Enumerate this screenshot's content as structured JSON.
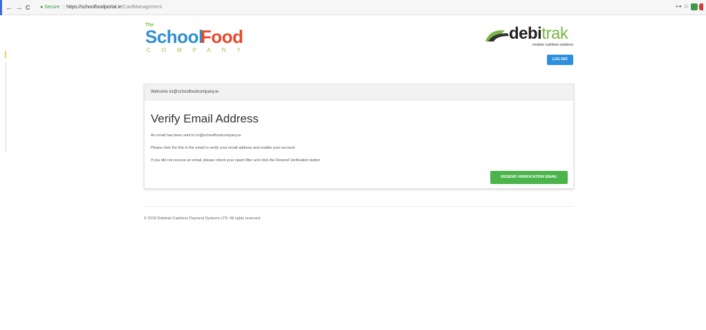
{
  "browser": {
    "back_icon": "←",
    "forward_icon": "→",
    "reload_icon": "C",
    "secure_label": "Secure",
    "url_host": "https://schoolfoodportal.ie",
    "url_path": "/CardManagement",
    "key_icon": "⊶",
    "star_icon": "☆"
  },
  "brand": {
    "sfc_the": "The",
    "sfc_school": "School",
    "sfc_food": "Food",
    "sfc_company": "COMPANY",
    "debi_prefix": "debi",
    "debi_suffix": "trak",
    "debi_tagline": "creative cashless solutions"
  },
  "header": {
    "logoff_label": "LOG OFF"
  },
  "card": {
    "welcome": "Welcome ict@schoolfoodcompany.ie",
    "title": "Verify Email Address",
    "line1": "An email has been sent to ict@schoolfoodcompany.ie",
    "line2": "Please click the link in the email to verify your email address and enable your account",
    "line3": "If you did not receive an email, please check your spam filter and click the Resend Verification button",
    "resend_label": "RESEND VERIFICATION EMAIL"
  },
  "footer": {
    "copyright": "© 2018 Debitrak Cashless Payment Systems LTD. All rights reserved"
  },
  "colors": {
    "primary_button": "#2e8fde",
    "success_button": "#4bb44b",
    "sfc_blue": "#2f8fd1",
    "sfc_red": "#e8492a",
    "debi_green": "#7ab648"
  }
}
